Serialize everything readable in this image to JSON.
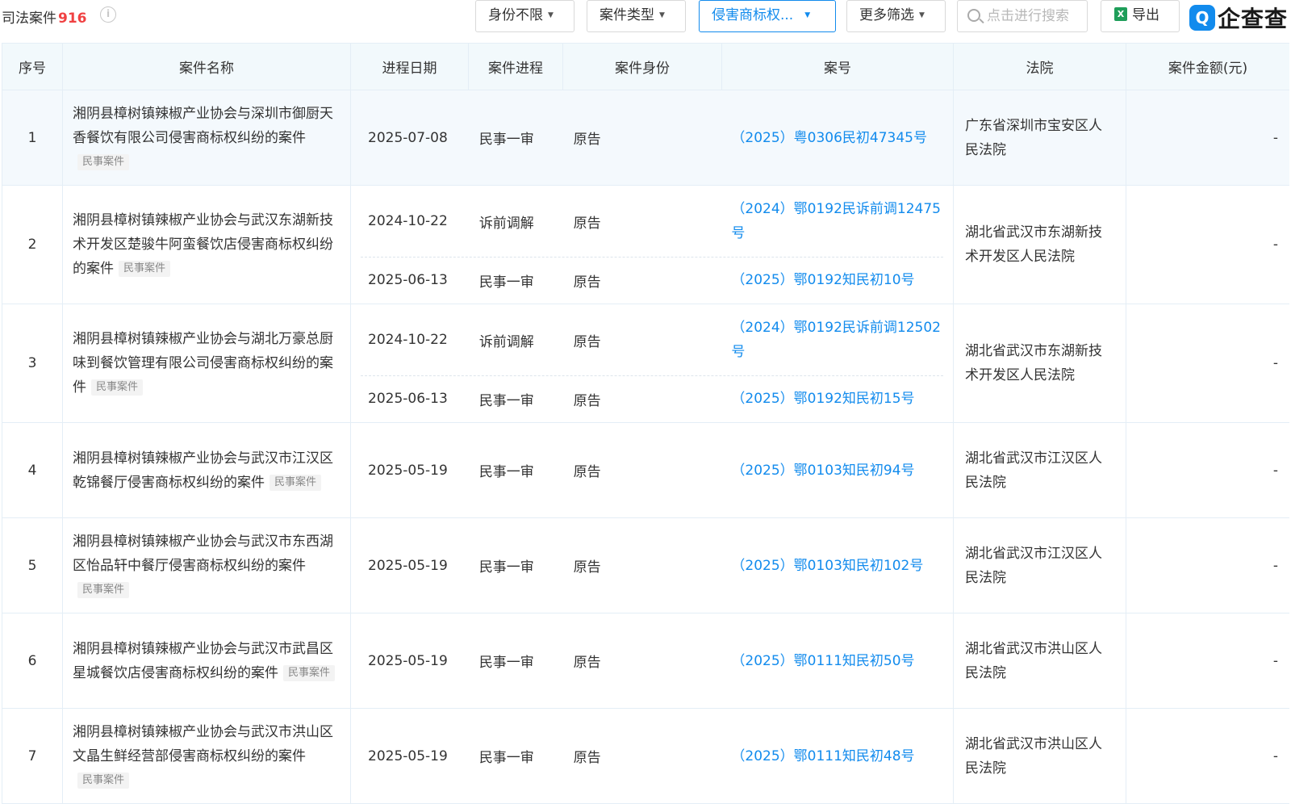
{
  "header": {
    "title": "司法案件",
    "count": "916",
    "info": "i",
    "filters": [
      "身份不限",
      "案件类型",
      "侵害商标权...",
      "更多筛选"
    ],
    "search_placeholder": "点击进行搜索",
    "export_label": "导出",
    "excel_icon": "X",
    "logo_mark": "Q",
    "logo_text": "企查查"
  },
  "columns": [
    "序号",
    "案件名称",
    "进程日期",
    "案件进程",
    "案件身份",
    "案号",
    "法院",
    "案件金额(元)"
  ],
  "rows": [
    {
      "no": "1",
      "name": "湘阴县樟树镇辣椒产业协会与深圳市御厨天香餐饮有限公司侵害商标权纠纷的案件",
      "tag": "民事案件",
      "entries": [
        {
          "date": "2025-07-08",
          "process": "民事一审",
          "role": "原告",
          "case_no": "（2025）粤0306民初47345号"
        }
      ],
      "court": "广东省深圳市宝安区人民法院",
      "amount": "-"
    },
    {
      "no": "2",
      "name": "湘阴县樟树镇辣椒产业协会与武汉东湖新技术开发区楚骏牛阿蛮餐饮店侵害商标权纠纷的案件",
      "tag": "民事案件",
      "entries": [
        {
          "date": "2024-10-22",
          "process": "诉前调解",
          "role": "原告",
          "case_no": "（2024）鄂0192民诉前调12475号"
        },
        {
          "date": "2025-06-13",
          "process": "民事一审",
          "role": "原告",
          "case_no": "（2025）鄂0192知民初10号"
        }
      ],
      "court": "湖北省武汉市东湖新技术开发区人民法院",
      "amount": "-"
    },
    {
      "no": "3",
      "name": "湘阴县樟树镇辣椒产业协会与湖北万豪总厨味到餐饮管理有限公司侵害商标权纠纷的案件",
      "tag": "民事案件",
      "entries": [
        {
          "date": "2024-10-22",
          "process": "诉前调解",
          "role": "原告",
          "case_no": "（2024）鄂0192民诉前调12502号"
        },
        {
          "date": "2025-06-13",
          "process": "民事一审",
          "role": "原告",
          "case_no": "（2025）鄂0192知民初15号"
        }
      ],
      "court": "湖北省武汉市东湖新技术开发区人民法院",
      "amount": "-"
    },
    {
      "no": "4",
      "name": "湘阴县樟树镇辣椒产业协会与武汉市江汉区乾锦餐厅侵害商标权纠纷的案件",
      "tag": "民事案件",
      "entries": [
        {
          "date": "2025-05-19",
          "process": "民事一审",
          "role": "原告",
          "case_no": "（2025）鄂0103知民初94号"
        }
      ],
      "court": "湖北省武汉市江汉区人民法院",
      "amount": "-"
    },
    {
      "no": "5",
      "name": "湘阴县樟树镇辣椒产业协会与武汉市东西湖区怡品轩中餐厅侵害商标权纠纷的案件",
      "tag": "民事案件",
      "entries": [
        {
          "date": "2025-05-19",
          "process": "民事一审",
          "role": "原告",
          "case_no": "（2025）鄂0103知民初102号"
        }
      ],
      "court": "湖北省武汉市江汉区人民法院",
      "amount": "-"
    },
    {
      "no": "6",
      "name": "湘阴县樟树镇辣椒产业协会与武汉市武昌区星城餐饮店侵害商标权纠纷的案件",
      "tag": "民事案件",
      "entries": [
        {
          "date": "2025-05-19",
          "process": "民事一审",
          "role": "原告",
          "case_no": "（2025）鄂0111知民初50号"
        }
      ],
      "court": "湖北省武汉市洪山区人民法院",
      "amount": "-"
    },
    {
      "no": "7",
      "name": "湘阴县樟树镇辣椒产业协会与武汉市洪山区文晶生鲜经营部侵害商标权纠纷的案件",
      "tag": "民事案件",
      "entries": [
        {
          "date": "2025-05-19",
          "process": "民事一审",
          "role": "原告",
          "case_no": "（2025）鄂0111知民初48号"
        }
      ],
      "court": "湖北省武汉市洪山区人民法院",
      "amount": "-"
    }
  ],
  "colors": {
    "accent": "#128bed",
    "count": "#f04142",
    "header_bg": "#f2f9fc"
  }
}
